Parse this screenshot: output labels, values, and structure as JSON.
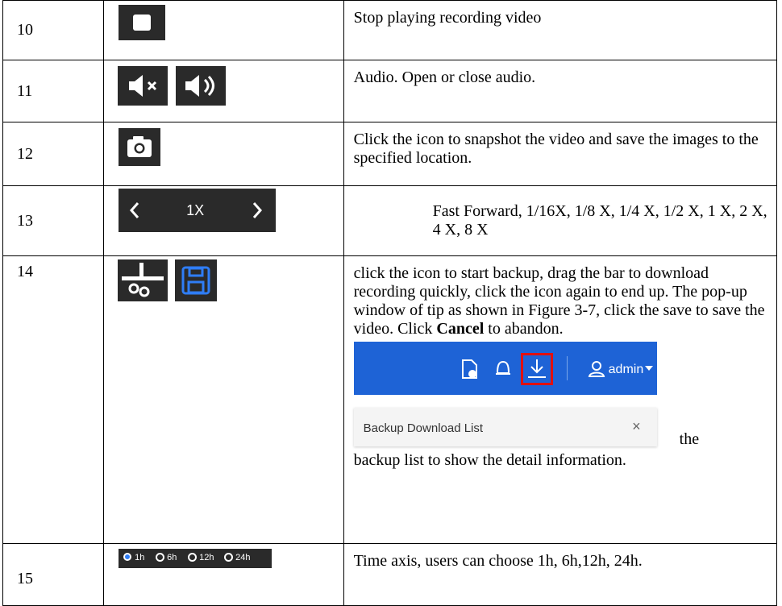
{
  "rows": [
    {
      "num": "10",
      "desc": "Stop playing recording video"
    },
    {
      "num": "11",
      "desc": "Audio. Open or close audio."
    },
    {
      "num": "12",
      "desc": "Click the icon to snapshot the video and save the images to the specified location."
    },
    {
      "num": "13",
      "desc": "Fast Forward, 1/16X, 1/8 X, 1/4 X, 1/2 X, 1 X, 2 X, 4 X, 8 X"
    },
    {
      "num": "14",
      "desc_before": "click the icon to start backup, drag the bar to download recording quickly, click the icon again to end up. The pop-up window of tip as shown in Figure 3-7, click the save to save the video. Click ",
      "desc_bold": "Cancel",
      "desc_after": " to abandon.",
      "desc_tail_1": "the",
      "desc_tail_2": "backup list to show the detail information."
    },
    {
      "num": "15",
      "desc": "Time axis, users can choose 1h, 6h,12h, 24h."
    }
  ],
  "speed_control": {
    "label": "1X",
    "prev": "<",
    "next": ">"
  },
  "header_ui": {
    "user": "admin",
    "panel_title": "Backup Download List",
    "close": "×",
    "bg": "#1e63d6"
  },
  "time_axis": {
    "options": [
      "1h",
      "6h",
      "12h",
      "24h"
    ],
    "selected": "1h"
  },
  "colors": {
    "icon_bg": "#2a2a2a",
    "save_icon": "#2f7df6",
    "highlight": "#e01010"
  }
}
